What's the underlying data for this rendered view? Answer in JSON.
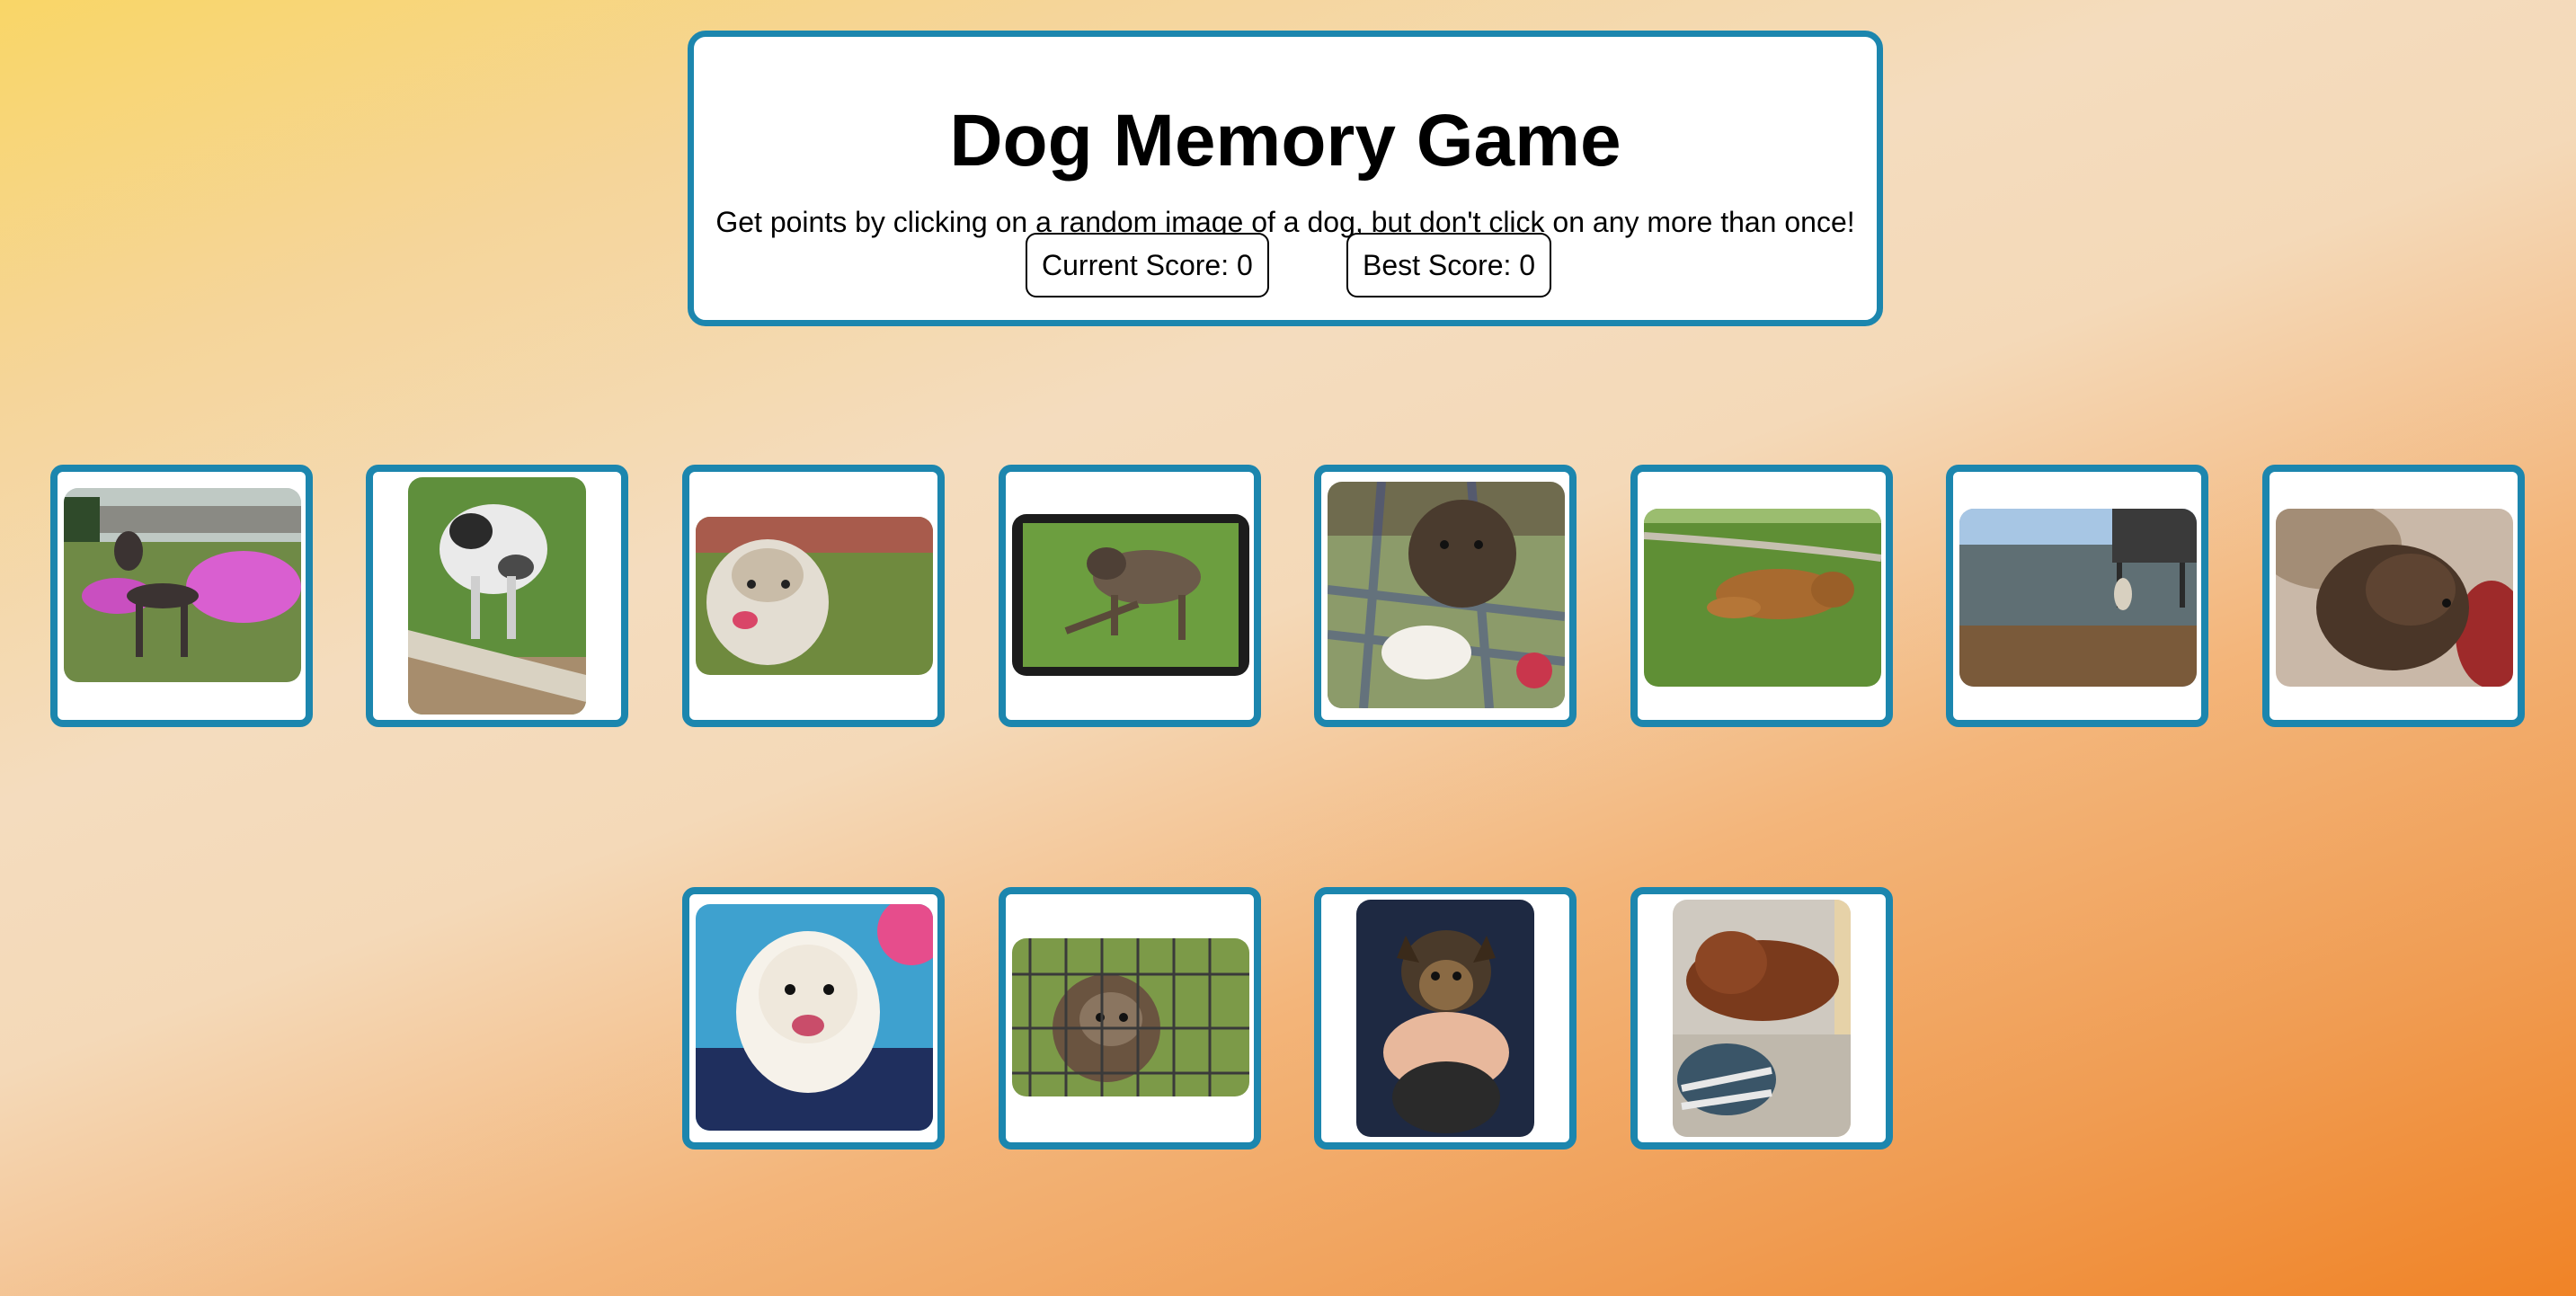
{
  "header": {
    "title": "Dog Memory Game",
    "subtitle": "Get points by clicking on a random image of a dog, but don't click on any more than once!",
    "current_score_label": "Current Score: 0",
    "best_score_label": "Best Score: 0",
    "current_score": 0,
    "best_score": 0
  },
  "colors": {
    "card_border": "#1c86ae",
    "card_background": "#ffffff",
    "page_gradient": [
      "#f9d667",
      "#f4dcbe",
      "#f08326"
    ]
  },
  "cards": [
    {
      "name": "dog-card-1",
      "image": "dog-photo"
    },
    {
      "name": "dog-card-2",
      "image": "dog-photo"
    },
    {
      "name": "dog-card-3",
      "image": "dog-photo"
    },
    {
      "name": "dog-card-4",
      "image": "dog-photo"
    },
    {
      "name": "dog-card-5",
      "image": "dog-photo"
    },
    {
      "name": "dog-card-6",
      "image": "dog-photo"
    },
    {
      "name": "dog-card-7",
      "image": "dog-photo"
    },
    {
      "name": "dog-card-8",
      "image": "dog-photo"
    },
    {
      "name": "dog-card-9",
      "image": "dog-photo"
    },
    {
      "name": "dog-card-10",
      "image": "dog-photo"
    },
    {
      "name": "dog-card-11",
      "image": "dog-photo"
    },
    {
      "name": "dog-card-12",
      "image": "dog-photo"
    }
  ]
}
